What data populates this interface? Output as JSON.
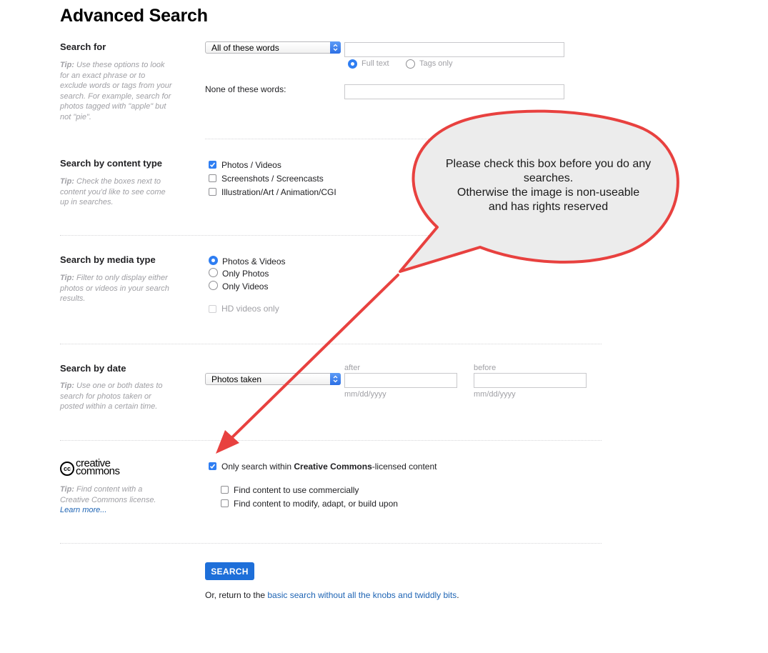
{
  "page": {
    "title": "Advanced Search"
  },
  "search_for": {
    "label": "Search for",
    "tip_bold": "Tip:",
    "tip": "Use these options to look for an exact phrase or to exclude words or tags from your search. For example, search for photos tagged with \"apple\" but not \"pie\".",
    "mode_select": "All of these words",
    "query_value": "",
    "scope_options": [
      "Full text",
      "Tags only"
    ],
    "scope_selected": "Full text",
    "none_label": "None of these words:",
    "none_value": ""
  },
  "content_type": {
    "label": "Search by content type",
    "tip_bold": "Tip:",
    "tip": "Check the boxes next to content you'd like to see come up in searches.",
    "options": [
      {
        "label": "Photos / Videos",
        "checked": true
      },
      {
        "label": "Screenshots / Screencasts",
        "checked": false
      },
      {
        "label": "Illustration/Art / Animation/CGI",
        "checked": false
      }
    ]
  },
  "media_type": {
    "label": "Search by media type",
    "tip_bold": "Tip:",
    "tip": "Filter to only display either photos or videos in your search results.",
    "options": [
      "Photos & Videos",
      "Only Photos",
      "Only Videos"
    ],
    "selected": "Photos & Videos",
    "hd_label": "HD videos only",
    "hd_checked": false,
    "hd_disabled": true
  },
  "date": {
    "label": "Search by date",
    "tip_bold": "Tip:",
    "tip": "Use one or both dates to search for photos taken or posted within a certain time.",
    "select": "Photos taken",
    "after_label": "after",
    "before_label": "before",
    "after_value": "",
    "before_value": "",
    "format_hint": "mm/dd/yyyy"
  },
  "creative_commons": {
    "logo_line1": "creative",
    "logo_line2": "commons",
    "logo_cc": "cc",
    "tip_bold": "Tip:",
    "tip": "Find content with a Creative Commons license.",
    "learn_more": "Learn more...",
    "main_prefix": "Only search within ",
    "main_bold": "Creative Commons",
    "main_suffix": "-licensed content",
    "main_checked": true,
    "sub_options": [
      {
        "label": "Find content to use commercially",
        "checked": false
      },
      {
        "label": "Find content to modify, adapt, or build upon",
        "checked": false
      }
    ]
  },
  "footer": {
    "search_button": "SEARCH",
    "return_prefix": "Or, return to the ",
    "return_link": "basic search without all the knobs and twiddly bits",
    "return_suffix": "."
  },
  "annotation": {
    "callout_lines": [
      "Please check this box before you do any",
      "searches.",
      "Otherwise the image is non-useable",
      "and has rights reserved"
    ],
    "stroke_color": "#e8413f",
    "fill_color": "#ececec"
  },
  "colors": {
    "accent": "#2f7ef2",
    "button": "#1e6fd9",
    "link": "#1e64b4",
    "tip": "#a0a0a5"
  }
}
